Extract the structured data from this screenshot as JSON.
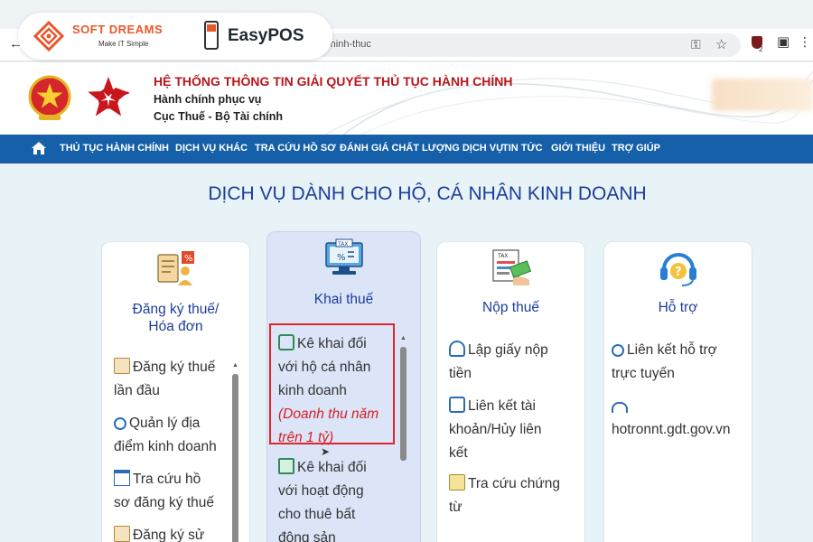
{
  "watermark": {
    "brand1_name": "SOFT DREAMS",
    "brand1_slogan": "Make IT Simple",
    "brand2_name": "EasyPOS"
  },
  "browser": {
    "url_visible": "h/chinh-thuc",
    "back_icon": "arrow-left-icon",
    "extension_badge": "2"
  },
  "header": {
    "title": "HỆ THỐNG THÔNG TIN GIẢI QUYẾT THỦ TỤC HÀNH CHÍNH",
    "subtitle1": "Hành chính phục vụ",
    "subtitle2": "Cục Thuế - Bộ Tài chính"
  },
  "nav": {
    "items": [
      "THỦ TỤC HÀNH CHÍNH",
      "DỊCH VỤ KHÁC",
      "TRA CỨU HỒ SƠ",
      "ĐÁNH GIÁ CHẤT LƯỢNG DỊCH VỤ",
      "TIN TỨC",
      "GIỚI THIỆU",
      "TRỢ GIÚP"
    ]
  },
  "page": {
    "title": "DỊCH VỤ DÀNH CHO HỘ, CÁ NHÂN KINH DOANH"
  },
  "cards": {
    "dang_ky": {
      "title_line1": "Đăng ký thuế/",
      "title_line2": "Hóa đơn",
      "items": [
        {
          "line1": "Đăng ký thuế",
          "line2": "lần đầu"
        },
        {
          "line1": "Quản lý địa",
          "line2": "điểm kinh doanh"
        },
        {
          "line1": "Tra cứu hồ",
          "line2": "sơ đăng ký thuế"
        },
        {
          "line1": "Đăng ký sử",
          "line2": ""
        }
      ]
    },
    "khai_thue": {
      "title": "Khai thuế",
      "icon_label": "TAX",
      "items": [
        {
          "line1": "Kê khai đối",
          "line2": "với hộ cá nhân",
          "line3": "kinh doanh",
          "note1": "(Doanh thu năm",
          "note2": "trên 1 tỷ)"
        },
        {
          "line1": "Kê khai đối",
          "line2": "với hoạt động",
          "line3": "cho thuê bất",
          "line4": "động sản"
        }
      ]
    },
    "nop_thue": {
      "title": "Nộp thuế",
      "icon_label": "TAX",
      "items": [
        {
          "line1": "Lập giấy nộp",
          "line2": "tiền"
        },
        {
          "line1": "Liên kết tài",
          "line2": "khoản/Hủy liên",
          "line3": "kết"
        },
        {
          "line1": "Tra cứu chứng",
          "line2": "từ"
        }
      ]
    },
    "ho_tro": {
      "title": "Hỗ trợ",
      "items": [
        {
          "line1": "Liên kết hỗ trợ",
          "line2": "trực tuyến"
        },
        {
          "line1": "",
          "line2": "hotronnt.gdt.gov.vn"
        }
      ]
    }
  },
  "colors": {
    "nav_bg": "#1560a8",
    "title_blue": "#1c3d9c",
    "header_red": "#b8161b",
    "note_red": "#d41f26",
    "highlight_red": "#e0242b"
  }
}
